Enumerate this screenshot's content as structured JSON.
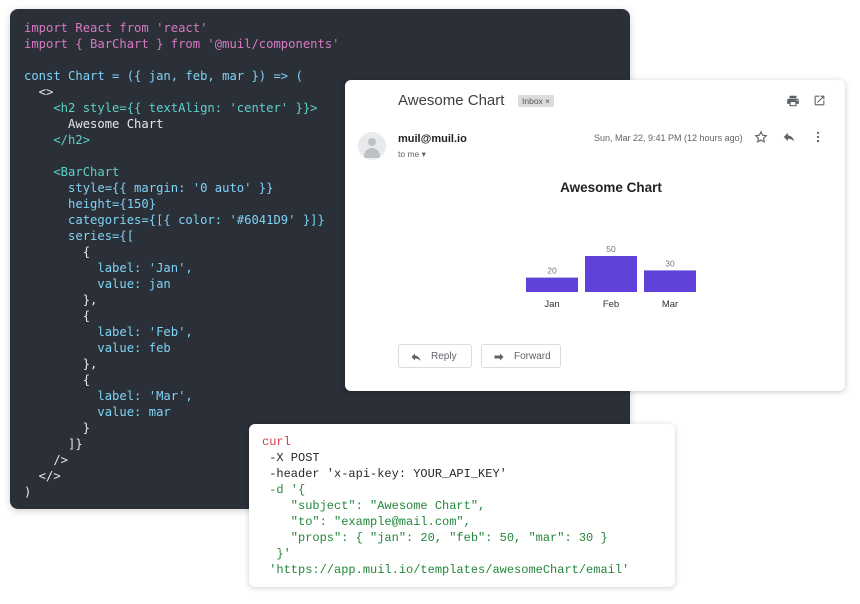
{
  "code_editor": {
    "lines": [
      "import React from 'react'",
      "import { BarChart } from '@muil/components'",
      "",
      "const Chart = ({ jan, feb, mar }) => (",
      "  <>",
      "    <h2 style={{ textAlign: 'center' }}>",
      "      Awesome Chart",
      "    </h2>",
      "",
      "    <BarChart",
      "      style={{ margin: '0 auto' }}",
      "      height={150}",
      "      categories={[{ color: '#6041D9' }]}",
      "      series={[",
      "        {",
      "          label: 'Jan',",
      "          value: jan",
      "        },",
      "        {",
      "          label: 'Feb',",
      "          value: feb",
      "        },",
      "        {",
      "          label: 'Mar',",
      "          value: mar",
      "        }",
      "      ]}",
      "    />",
      "  </>",
      ")"
    ]
  },
  "email": {
    "subject": "Awesome Chart",
    "inbox_label": "Inbox ×",
    "sender": "muil@muil.io",
    "to_label": "to me ▾",
    "datetime": "Sun, Mar 22, 9:41 PM (12 hours ago)",
    "icons": {
      "print": "print-icon",
      "open_new": "open-in-new-icon",
      "star": "star-icon",
      "reply": "reply-icon",
      "more": "more-vert-icon"
    },
    "reply_button": "Reply",
    "forward_button": "Forward"
  },
  "chart_data": {
    "type": "bar",
    "title": "Awesome Chart",
    "categories": [
      "Jan",
      "Feb",
      "Mar"
    ],
    "values": [
      20,
      50,
      30
    ],
    "color": "#6041D9",
    "ylim": [
      0,
      50
    ]
  },
  "curl": {
    "lines": [
      "curl",
      " -X POST",
      " -header 'x-api-key: YOUR_API_KEY'",
      " -d '{",
      "    \"subject\": \"Awesome Chart\",",
      "    \"to\": \"example@mail.com\",",
      "    \"props\": { \"jan\": 20, \"feb\": 50, \"mar\": 30 }",
      "  }'",
      " 'https://app.muil.io/templates/awesomeChart/email'"
    ]
  }
}
